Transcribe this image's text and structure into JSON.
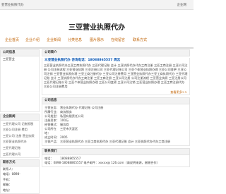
{
  "topbar": {
    "site": "亚营业执照代办",
    "right": "企业网"
  },
  "title": "三亚营业执照代办",
  "nav": [
    "企业首页",
    "企业介绍",
    "企业新闻",
    "分类信息",
    "图片展示",
    "在线留言",
    "联系方式"
  ],
  "left": {
    "company_label": "公司信息",
    "company_lines": [
      "三亚营业",
      "执照代办",
      "0898-"
    ],
    "news_head": "",
    "news_items": [],
    "links_head": "企业新闻",
    "links": [
      "三亚代理公司 记账报税",
      "三亚公司注册 费用",
      "三亚公司 注册 营业执照",
      "三亚营业执照代办",
      "三亚代理记账",
      "三亚代理公司"
    ],
    "contact_head": "联系方式",
    "contact_lines": [
      "联系人：",
      "电话：0898-",
      "手机：",
      "邮箱：",
      "地址：",
      "三亚代理公司注册",
      "三亚营业执照代办"
    ]
  },
  "main": {
    "company_head": "公司简介",
    "company_name": "三亚营业执照代办  咨询电话：18088865557 周云",
    "para": "三亚营业执照代办三亚工商执照代办 三亚代理记账 会计 三亚执照代办代办工商注册 三亚工商注册 三亚公司注册 公司注册流程 三亚营业执照 三亚注册公司 三亚代理记账公司 三亚个体营业执照办理 三亚公司变更 三亚公司注销 三亚营业执照办理 三亚工商注册代办 三亚公司注册费用 三亚营业执照代办三亚工商执照代办 三亚代理记账 会计 三亚执照代办代办工商注册 三亚工商注册 三亚公司注册 公司注册流程 三亚营业执照 三亚注册公司 三亚代理记账公司 三亚个体营业执照办理 三亚公司变更 三亚公司注销 三亚营业执照办理 三亚工商注册代办 三亚公司注册费用",
    "more": "查看更多>>",
    "info_head": "公司信息",
    "info": [
      {
        "k": "主营业务：",
        "v": "营业执照代办 代理记账 公司注册"
      },
      {
        "k": "所属行业：",
        "v": "商务服务"
      },
      {
        "k": "公司类型：",
        "v": "私营有限责任公司"
      },
      {
        "k": "注册资本：",
        "v": "100万"
      },
      {
        "k": "经营模式：",
        "v": "服务商"
      },
      {
        "k": "公司所在地：",
        "v": "三亚市天涯区"
      },
      {
        "k": "成立时间：",
        "v": "2005"
      },
      {
        "k": "主营产品：",
        "v": "三亚营业执照代办 三亚工商执照代办 三亚代理记账 会计 三亚执照代办代办工商注册"
      }
    ],
    "contact_head": "联系我们",
    "phone_label": "电话：",
    "phone": "18088865557",
    "contact_line": "电话：0898-18088865557  电子邮件：xxxxx@ 126.com（请说明来源，谢谢合作）"
  }
}
